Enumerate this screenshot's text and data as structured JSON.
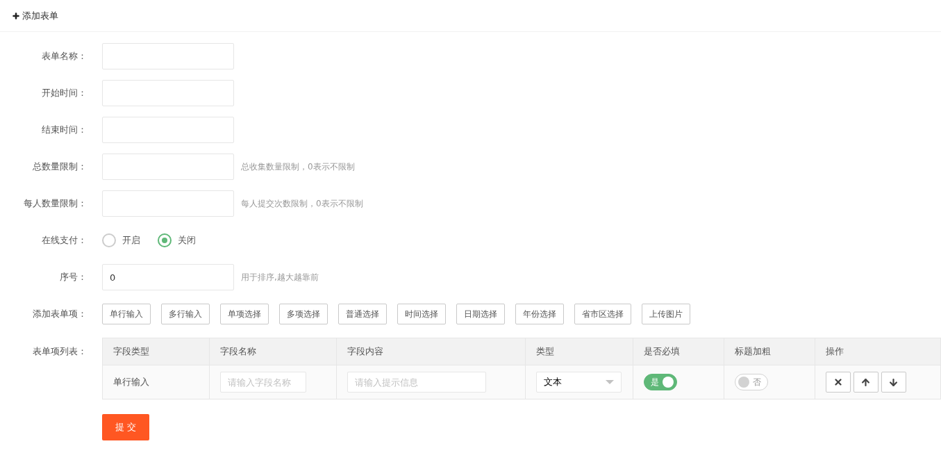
{
  "header": {
    "title": "添加表单"
  },
  "form": [
    {
      "kind": "input",
      "label": "表单名称："
    },
    {
      "kind": "input",
      "label": "开始时间："
    },
    {
      "kind": "input",
      "label": "结束时间："
    },
    {
      "kind": "input",
      "label": "总数量限制：",
      "hint": "总收集数量限制，0表示不限制"
    },
    {
      "kind": "input",
      "label": "每人数量限制：",
      "hint": "每人提交次数限制，0表示不限制"
    },
    {
      "kind": "radio",
      "label": "在线支付：",
      "options": [
        {
          "label": "开启",
          "selected": false
        },
        {
          "label": "关闭",
          "selected": true
        }
      ]
    },
    {
      "kind": "input",
      "label": "序号：",
      "value": "0",
      "hint": "用于排序,越大越靠前"
    },
    {
      "kind": "buttons",
      "label": "添加表单项：",
      "buttons": [
        "单行输入",
        "多行输入",
        "单项选择",
        "多项选择",
        "普通选择",
        "时间选择",
        "日期选择",
        "年份选择",
        "省市区选择",
        "上传图片"
      ]
    },
    {
      "kind": "table",
      "label": "表单项列表：",
      "columns": [
        "字段类型",
        "字段名称",
        "字段内容",
        "类型",
        "是否必填",
        "标题加粗",
        "操作"
      ],
      "rows": [
        {
          "field_type": "单行输入",
          "name_placeholder": "请输入字段名称",
          "content_placeholder": "请输入提示信息",
          "type": "文本",
          "required": {
            "on": true,
            "label": "是"
          },
          "bold": {
            "on": false,
            "label": "否"
          }
        }
      ]
    }
  ],
  "submit": "提 交"
}
